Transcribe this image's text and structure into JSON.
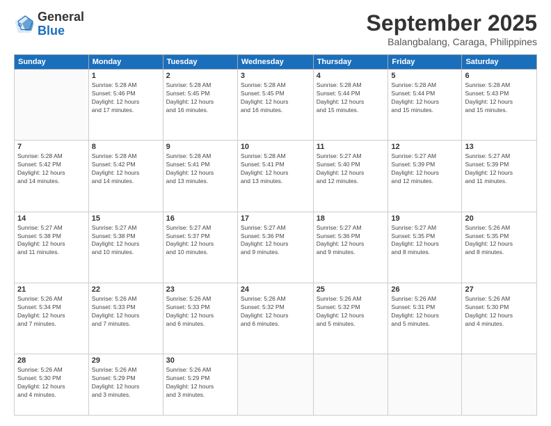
{
  "header": {
    "logo": {
      "line1": "General",
      "line2": "Blue"
    },
    "title": "September 2025",
    "location": "Balangbalang, Caraga, Philippines"
  },
  "weekdays": [
    "Sunday",
    "Monday",
    "Tuesday",
    "Wednesday",
    "Thursday",
    "Friday",
    "Saturday"
  ],
  "weeks": [
    [
      {
        "day": "",
        "info": ""
      },
      {
        "day": "1",
        "info": "Sunrise: 5:28 AM\nSunset: 5:46 PM\nDaylight: 12 hours\nand 17 minutes."
      },
      {
        "day": "2",
        "info": "Sunrise: 5:28 AM\nSunset: 5:45 PM\nDaylight: 12 hours\nand 16 minutes."
      },
      {
        "day": "3",
        "info": "Sunrise: 5:28 AM\nSunset: 5:45 PM\nDaylight: 12 hours\nand 16 minutes."
      },
      {
        "day": "4",
        "info": "Sunrise: 5:28 AM\nSunset: 5:44 PM\nDaylight: 12 hours\nand 15 minutes."
      },
      {
        "day": "5",
        "info": "Sunrise: 5:28 AM\nSunset: 5:44 PM\nDaylight: 12 hours\nand 15 minutes."
      },
      {
        "day": "6",
        "info": "Sunrise: 5:28 AM\nSunset: 5:43 PM\nDaylight: 12 hours\nand 15 minutes."
      }
    ],
    [
      {
        "day": "7",
        "info": "Sunrise: 5:28 AM\nSunset: 5:42 PM\nDaylight: 12 hours\nand 14 minutes."
      },
      {
        "day": "8",
        "info": "Sunrise: 5:28 AM\nSunset: 5:42 PM\nDaylight: 12 hours\nand 14 minutes."
      },
      {
        "day": "9",
        "info": "Sunrise: 5:28 AM\nSunset: 5:41 PM\nDaylight: 12 hours\nand 13 minutes."
      },
      {
        "day": "10",
        "info": "Sunrise: 5:28 AM\nSunset: 5:41 PM\nDaylight: 12 hours\nand 13 minutes."
      },
      {
        "day": "11",
        "info": "Sunrise: 5:27 AM\nSunset: 5:40 PM\nDaylight: 12 hours\nand 12 minutes."
      },
      {
        "day": "12",
        "info": "Sunrise: 5:27 AM\nSunset: 5:39 PM\nDaylight: 12 hours\nand 12 minutes."
      },
      {
        "day": "13",
        "info": "Sunrise: 5:27 AM\nSunset: 5:39 PM\nDaylight: 12 hours\nand 11 minutes."
      }
    ],
    [
      {
        "day": "14",
        "info": "Sunrise: 5:27 AM\nSunset: 5:38 PM\nDaylight: 12 hours\nand 11 minutes."
      },
      {
        "day": "15",
        "info": "Sunrise: 5:27 AM\nSunset: 5:38 PM\nDaylight: 12 hours\nand 10 minutes."
      },
      {
        "day": "16",
        "info": "Sunrise: 5:27 AM\nSunset: 5:37 PM\nDaylight: 12 hours\nand 10 minutes."
      },
      {
        "day": "17",
        "info": "Sunrise: 5:27 AM\nSunset: 5:36 PM\nDaylight: 12 hours\nand 9 minutes."
      },
      {
        "day": "18",
        "info": "Sunrise: 5:27 AM\nSunset: 5:36 PM\nDaylight: 12 hours\nand 9 minutes."
      },
      {
        "day": "19",
        "info": "Sunrise: 5:27 AM\nSunset: 5:35 PM\nDaylight: 12 hours\nand 8 minutes."
      },
      {
        "day": "20",
        "info": "Sunrise: 5:26 AM\nSunset: 5:35 PM\nDaylight: 12 hours\nand 8 minutes."
      }
    ],
    [
      {
        "day": "21",
        "info": "Sunrise: 5:26 AM\nSunset: 5:34 PM\nDaylight: 12 hours\nand 7 minutes."
      },
      {
        "day": "22",
        "info": "Sunrise: 5:26 AM\nSunset: 5:33 PM\nDaylight: 12 hours\nand 7 minutes."
      },
      {
        "day": "23",
        "info": "Sunrise: 5:26 AM\nSunset: 5:33 PM\nDaylight: 12 hours\nand 6 minutes."
      },
      {
        "day": "24",
        "info": "Sunrise: 5:26 AM\nSunset: 5:32 PM\nDaylight: 12 hours\nand 6 minutes."
      },
      {
        "day": "25",
        "info": "Sunrise: 5:26 AM\nSunset: 5:32 PM\nDaylight: 12 hours\nand 5 minutes."
      },
      {
        "day": "26",
        "info": "Sunrise: 5:26 AM\nSunset: 5:31 PM\nDaylight: 12 hours\nand 5 minutes."
      },
      {
        "day": "27",
        "info": "Sunrise: 5:26 AM\nSunset: 5:30 PM\nDaylight: 12 hours\nand 4 minutes."
      }
    ],
    [
      {
        "day": "28",
        "info": "Sunrise: 5:26 AM\nSunset: 5:30 PM\nDaylight: 12 hours\nand 4 minutes."
      },
      {
        "day": "29",
        "info": "Sunrise: 5:26 AM\nSunset: 5:29 PM\nDaylight: 12 hours\nand 3 minutes."
      },
      {
        "day": "30",
        "info": "Sunrise: 5:26 AM\nSunset: 5:29 PM\nDaylight: 12 hours\nand 3 minutes."
      },
      {
        "day": "",
        "info": ""
      },
      {
        "day": "",
        "info": ""
      },
      {
        "day": "",
        "info": ""
      },
      {
        "day": "",
        "info": ""
      }
    ]
  ]
}
